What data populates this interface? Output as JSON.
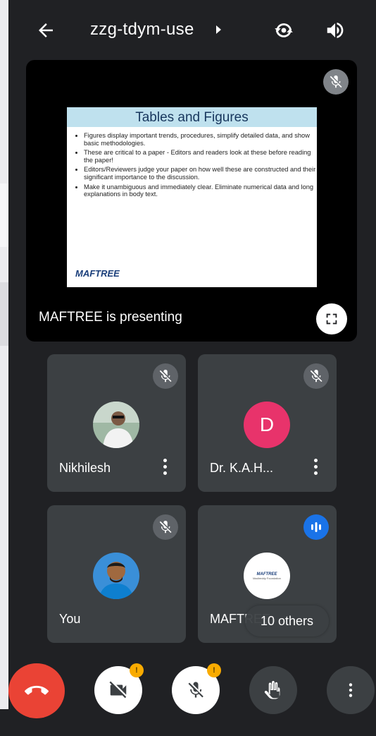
{
  "meeting": {
    "code": "zzg-tdym-use"
  },
  "presentation": {
    "label": "MAFTREE is presenting",
    "slide": {
      "title": "Tables and Figures",
      "bullets": [
        "Figures display important trends, procedures, simplify detailed data, and show basic methodologies.",
        "These are critical to a paper - Editors and readers look at these before reading the paper!",
        "Editors/Reviewers judge your paper on how well these are constructed and their significant importance to the discussion.",
        "Make it unambiguous and immediately clear. Eliminate numerical data and long explanations in body text."
      ],
      "logo": "MAFTREE"
    }
  },
  "participants": [
    {
      "name": "Nikhilesh",
      "mic": "muted"
    },
    {
      "name": "Dr. K.A.H...",
      "initial": "D",
      "mic": "muted"
    },
    {
      "name": "You",
      "mic": "muted"
    },
    {
      "name": "MAFTREE",
      "mic": "speaking"
    }
  ],
  "others_label": "10 others",
  "controls": {
    "camera_badge": "!",
    "mic_badge": "!"
  },
  "colors": {
    "background": "#202124",
    "tile": "#3c4043",
    "end_call": "#ea4335",
    "speaking": "#1a73e8",
    "avatar_d": "#e8336b",
    "warning": "#f9ab00"
  }
}
